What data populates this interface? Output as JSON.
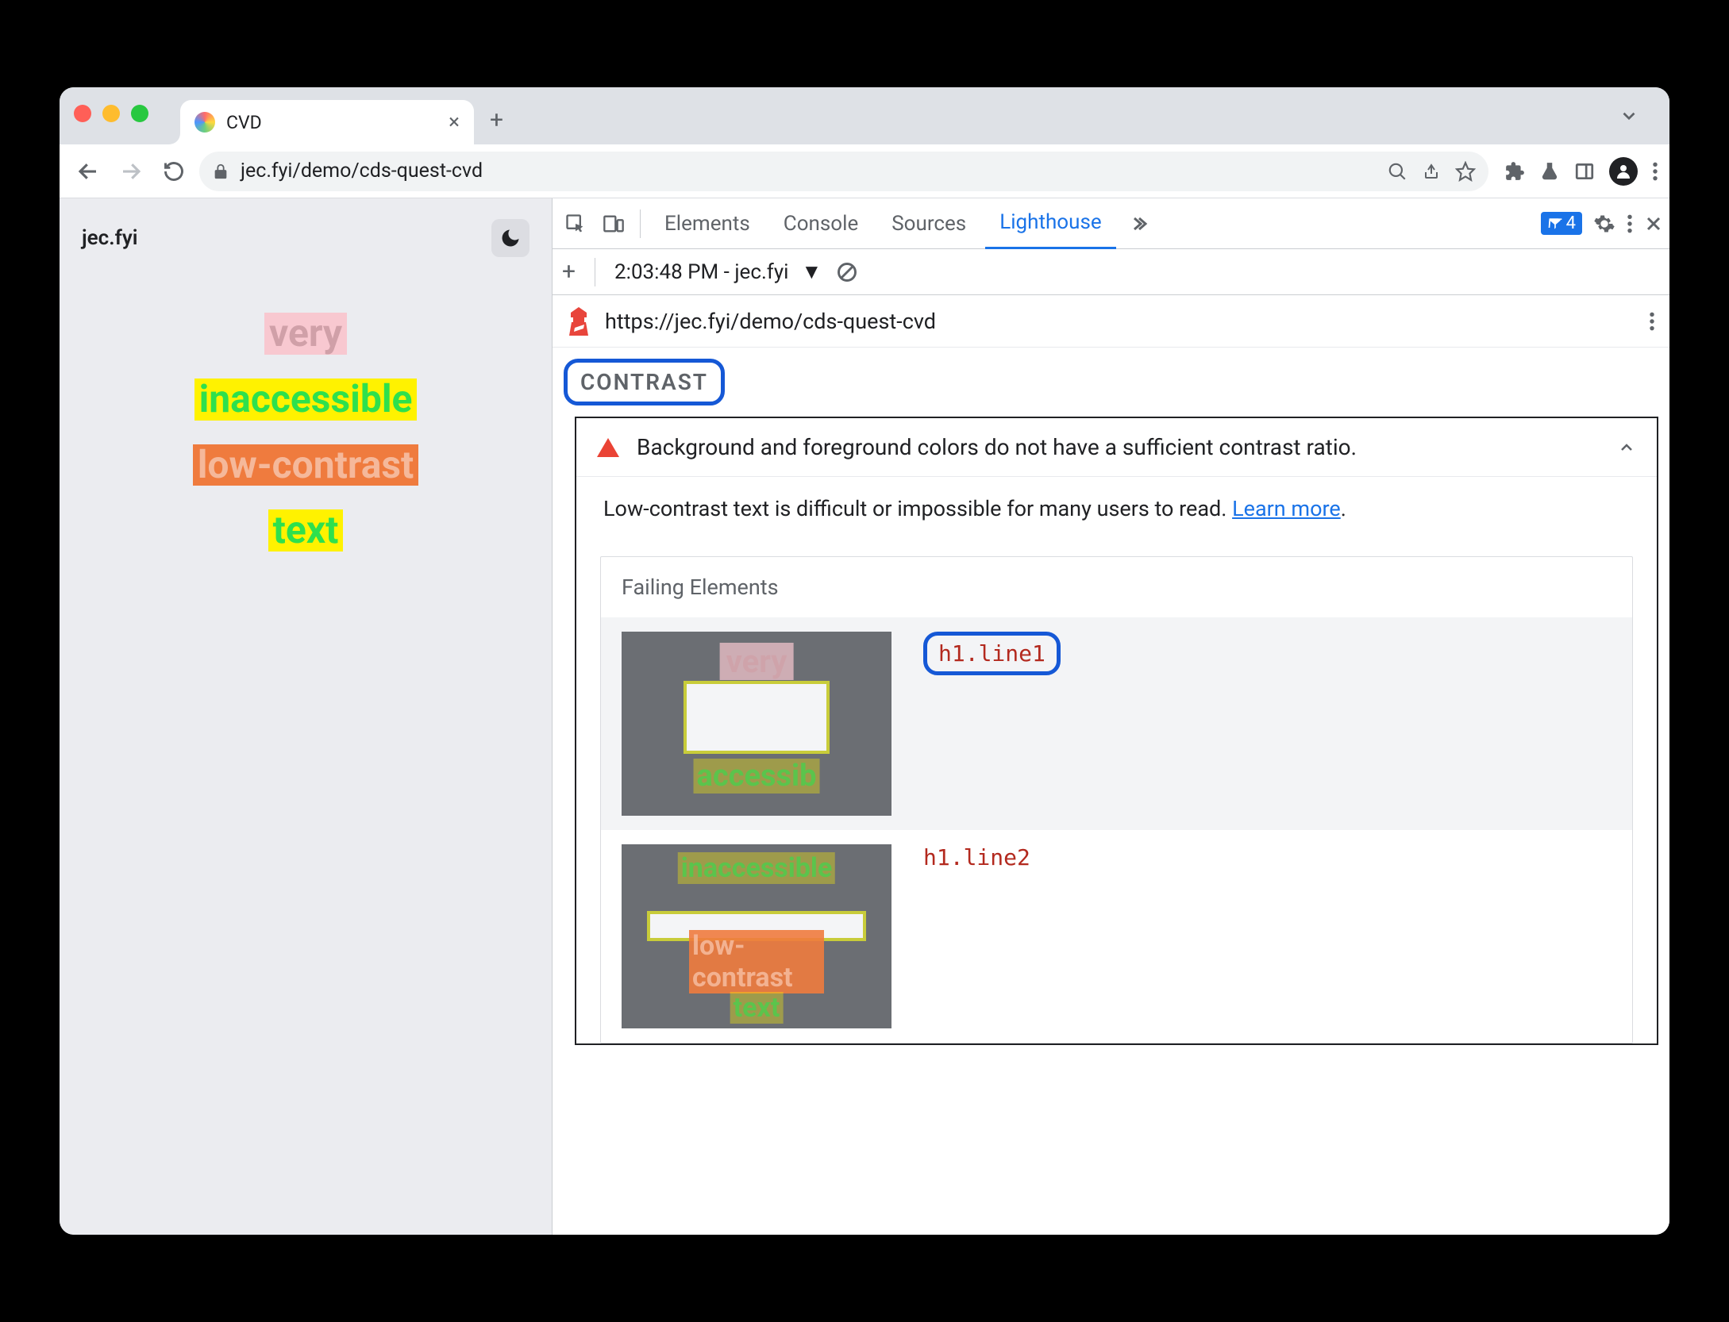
{
  "browser": {
    "tab_title": "CVD",
    "url": "jec.fyi/demo/cds-quest-cvd"
  },
  "page": {
    "site_title": "jec.fyi",
    "lines": {
      "line1": "very",
      "line2": "inaccessible",
      "line3": "low-contrast",
      "line4": "text"
    }
  },
  "devtools": {
    "tabs": {
      "elements": "Elements",
      "console": "Console",
      "sources": "Sources",
      "lighthouse": "Lighthouse"
    },
    "issue_count": "4",
    "lh_toolbar": {
      "timestamp": "2:03:48 PM - jec.fyi"
    },
    "lh_url": "https://jec.fyi/demo/cds-quest-cvd",
    "section_label": "CONTRAST",
    "audit": {
      "title": "Background and foreground colors do not have a sufficient contrast ratio.",
      "description_pre": "Low-contrast text is difficult or impossible for many users to read. ",
      "learn_more": "Learn more",
      "description_post": ".",
      "failing_header": "Failing Elements",
      "items": [
        {
          "selector": "h1.line1"
        },
        {
          "selector": "h1.line2"
        }
      ]
    }
  }
}
